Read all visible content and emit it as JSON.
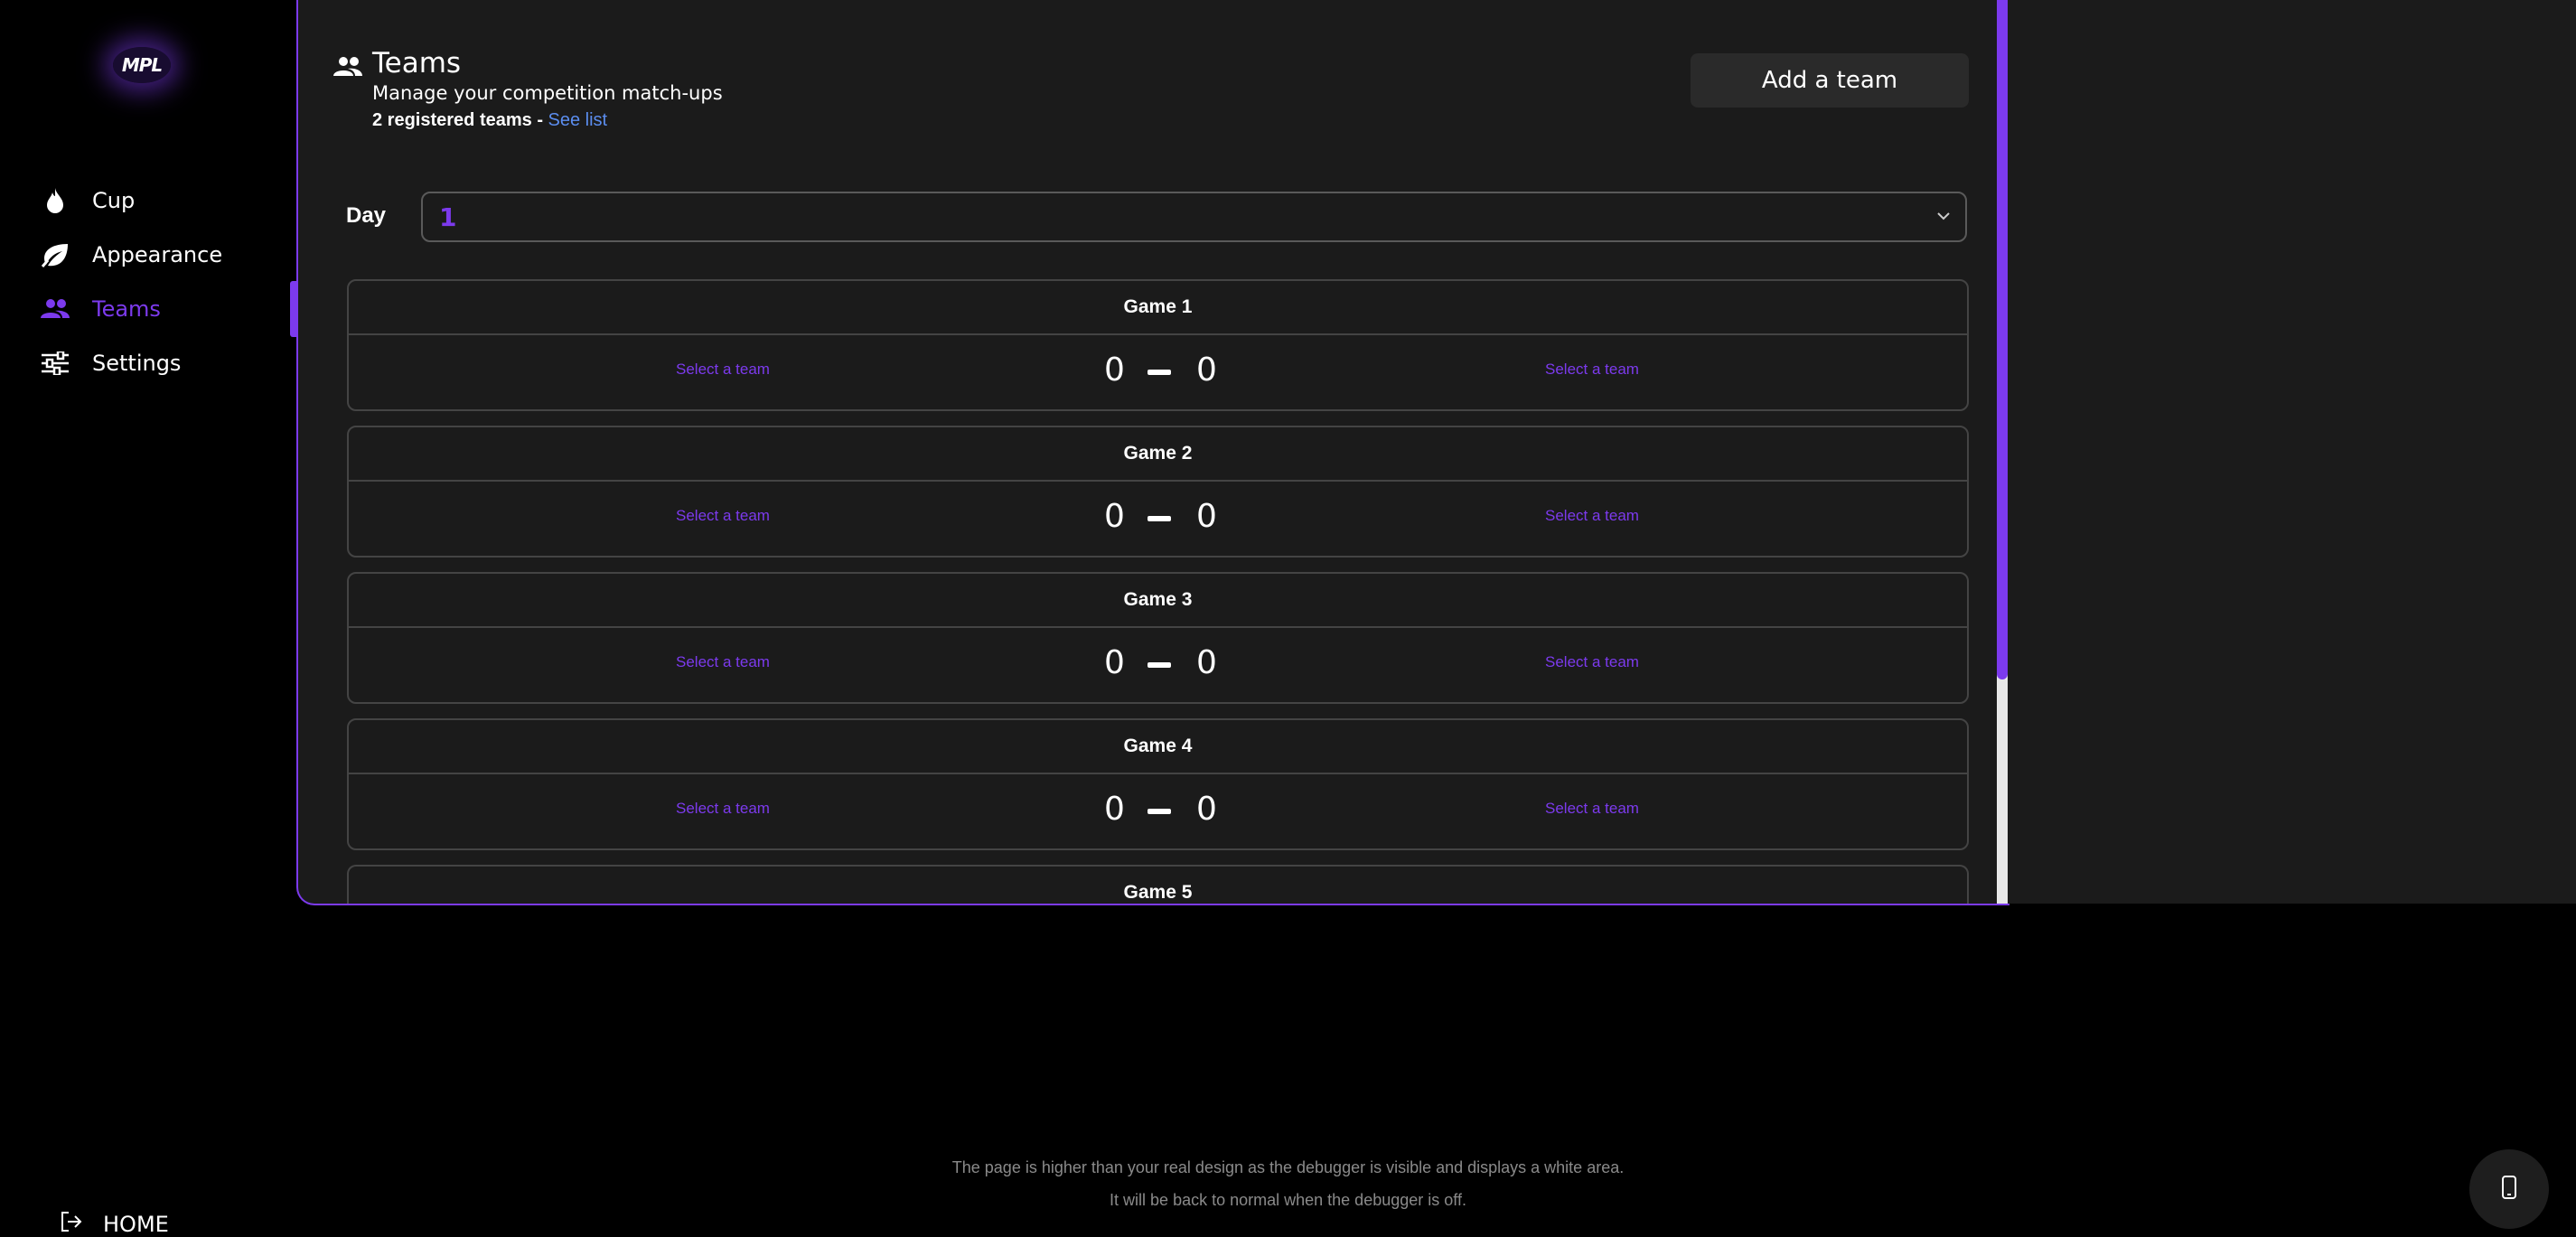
{
  "sidebar": {
    "logo_text": "MPL",
    "items": [
      {
        "label": "Cup",
        "icon": "flame-icon"
      },
      {
        "label": "Appearance",
        "icon": "leaf-icon"
      },
      {
        "label": "Teams",
        "icon": "people-icon",
        "active": true
      },
      {
        "label": "Settings",
        "icon": "sliders-icon"
      }
    ],
    "home_label": "HOME"
  },
  "header": {
    "title": "Teams",
    "subtitle": "Manage your competition match-ups",
    "count_text": "2 registered teams - ",
    "see_list": "See list",
    "add_button": "Add a team"
  },
  "day": {
    "label": "Day",
    "value": "1"
  },
  "games": [
    {
      "title": "Game 1",
      "left_team": "Select a team",
      "right_team": "Select a team",
      "score_left": "0",
      "score_right": "0"
    },
    {
      "title": "Game 2",
      "left_team": "Select a team",
      "right_team": "Select a team",
      "score_left": "0",
      "score_right": "0"
    },
    {
      "title": "Game 3",
      "left_team": "Select a team",
      "right_team": "Select a team",
      "score_left": "0",
      "score_right": "0"
    },
    {
      "title": "Game 4",
      "left_team": "Select a team",
      "right_team": "Select a team",
      "score_left": "0",
      "score_right": "0"
    },
    {
      "title": "Game 5"
    }
  ],
  "debug_note": {
    "line1": "The page is higher than your real design as the debugger is visible and displays a white area.",
    "line2": "It will be back to normal when the debugger is off."
  },
  "colors": {
    "accent": "#7c3aed",
    "link": "#5b8def",
    "panel": "#1b1b1b"
  }
}
